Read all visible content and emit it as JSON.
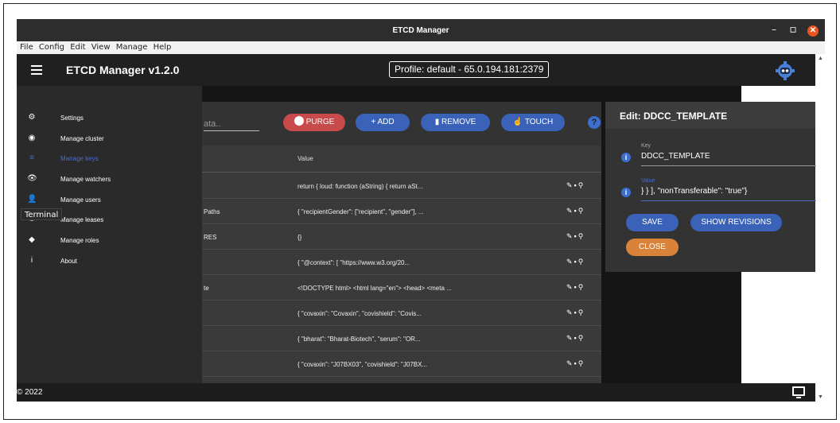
{
  "window": {
    "title": "ETCD Manager",
    "min": "–",
    "max": "◻",
    "close": "✕"
  },
  "menubar": [
    "File",
    "Config",
    "Edit",
    "View",
    "Manage",
    "Help"
  ],
  "appbar": {
    "title": "ETCD Manager v1.2.0",
    "profile": "Profile: default - 65.0.194.181:2379",
    "gear_icon": "robot-gear-icon"
  },
  "drawer": {
    "items": [
      {
        "label": "Settings",
        "icon": "⚙"
      },
      {
        "label": "Manage cluster",
        "icon": "◉"
      },
      {
        "label": "Manage keys",
        "icon": "≡"
      },
      {
        "label": "Manage watchers",
        "icon": "👁"
      },
      {
        "label": "Manage users",
        "icon": "👤"
      },
      {
        "label": "Manage leases",
        "icon": "⏱"
      },
      {
        "label": "Manage roles",
        "icon": "◆"
      },
      {
        "label": "About",
        "icon": "i"
      }
    ],
    "active": "Manage keys",
    "tooltip": "Terminal"
  },
  "toolbar": {
    "search_text": "ata..",
    "purge": "PURGE",
    "add": "+ ADD",
    "remove": "REMOVE",
    "touch": "TOUCH",
    "help": "?"
  },
  "table": {
    "value_header": "Value",
    "rows": [
      {
        "key": "",
        "value": "return { loud: function (aString) { return aSt..."
      },
      {
        "key": "Paths",
        "value": "{ \"recipientGender\": [\"recipient\", \"gender\"], ..."
      },
      {
        "key": "RES",
        "value": "{}"
      },
      {
        "key": "",
        "value": "{ \"@context\": [ \"https://www.w3.org/20..."
      },
      {
        "key": "te",
        "value": "<!DOCTYPE html> <html lang=\"en\"> <head> <meta ..."
      },
      {
        "key": "",
        "value": "{ \"covaxin\": \"Covaxin\", \"covishield\": \"Covis..."
      },
      {
        "key": "",
        "value": "{ \"bharat\": \"Bharat-Biotech\", \"serum\": \"OR..."
      },
      {
        "key": "",
        "value": "{ \"covaxin\": \"J07BX03\", \"covishield\": \"J07BX..."
      }
    ],
    "actions": "✎▪⚲"
  },
  "edit": {
    "header": "Edit: DDCC_TEMPLATE",
    "key_label": "Key",
    "key_value": "DDCC_TEMPLATE",
    "value_label": "Value",
    "value_value": "    }      }  ],   \"nonTransferable\": \"true\"}",
    "save": "SAVE",
    "show_revisions": "SHOW REVISIONS",
    "close": "CLOSE"
  },
  "footer": {
    "copyright": "© 2022"
  }
}
